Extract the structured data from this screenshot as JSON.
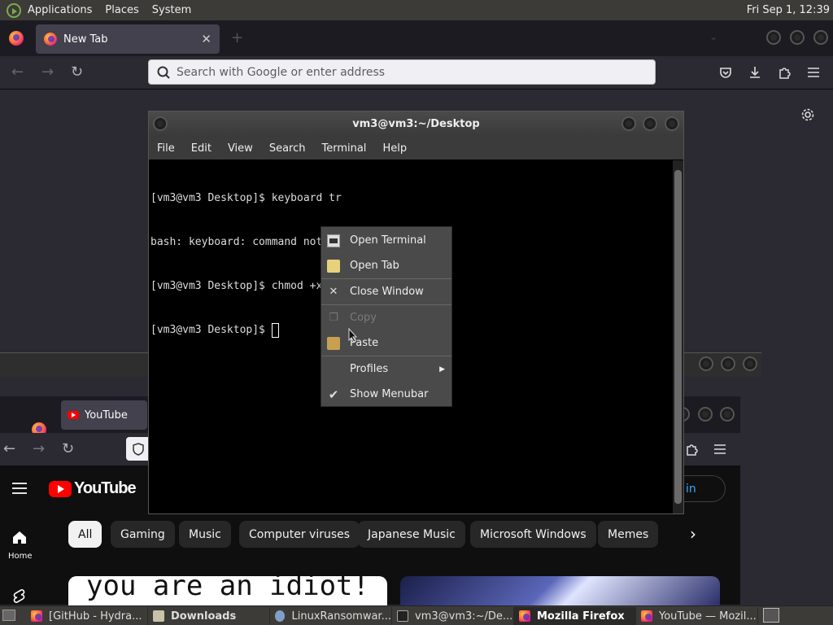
{
  "panel": {
    "menus": [
      "Applications",
      "Places",
      "System"
    ],
    "clock": "Fri Sep  1, 12:39"
  },
  "firefox": {
    "tab_label": "New Tab",
    "url_placeholder": "Search with Google or enter address"
  },
  "terminal": {
    "title": "vm3@vm3:~/Desktop",
    "menu": [
      "File",
      "Edit",
      "View",
      "Search",
      "Terminal",
      "Help"
    ],
    "lines": [
      "[vm3@vm3 Desktop]$ keyboard tr",
      "bash: keyboard: command not found",
      "[vm3@vm3 Desktop]$ chmod +x mygame.sh",
      "[vm3@vm3 Desktop]$ "
    ]
  },
  "context_menu": {
    "items": [
      {
        "label": "Open Terminal",
        "icon": "terminal-icon"
      },
      {
        "label": "Open Tab",
        "icon": "tab-icon"
      },
      {
        "label": "Close Window",
        "icon": "close-icon"
      },
      {
        "label": "Copy",
        "icon": "copy-icon",
        "disabled": true
      },
      {
        "label": "Paste",
        "icon": "paste-icon"
      },
      {
        "label": "Profiles",
        "icon": "",
        "submenu": true
      },
      {
        "label": "Show Menubar",
        "icon": "check-icon",
        "checked": true
      }
    ]
  },
  "youtube_window": {
    "tab_label": "YouTube",
    "logo_text": "YouTube",
    "sign_in": "Sign in",
    "home_label": "Home",
    "chips": [
      "All",
      "Gaming",
      "Music",
      "Computer viruses",
      "Japanese Music",
      "Microsoft Windows",
      "Memes"
    ],
    "thumbnail_text": "you are an idiot!"
  },
  "taskbar": {
    "tasks": [
      {
        "label": "[GitHub - Hydra..."
      },
      {
        "label": "Downloads"
      },
      {
        "label": "LinuxRansomwar..."
      },
      {
        "label": "vm3@vm3:~/De..."
      },
      {
        "label": "Mozilla Firefox"
      },
      {
        "label": "YouTube — Mozil..."
      }
    ]
  }
}
